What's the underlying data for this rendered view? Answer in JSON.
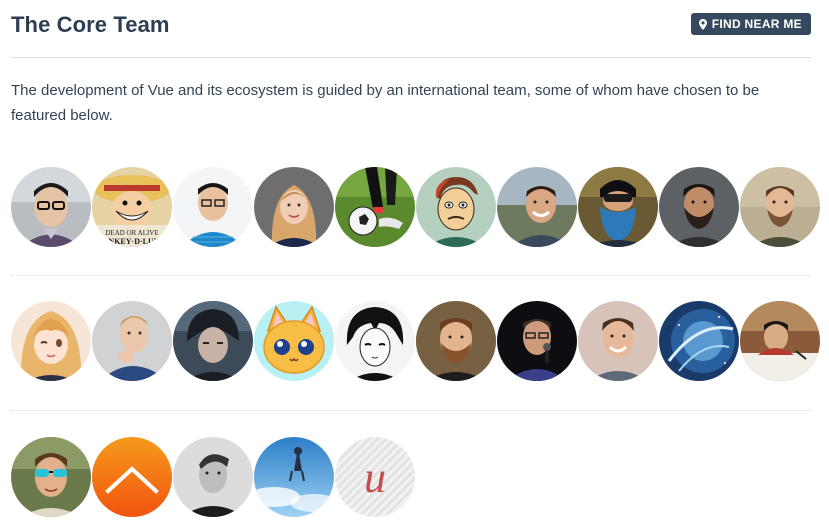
{
  "header": {
    "title": "The Core Team",
    "find_button_label": "FIND NEAR ME"
  },
  "description": "The development of Vue and its ecosystem is guided by an international team, some of whom have chosen to be featured below.",
  "avatars": {
    "row1": [
      {
        "name": "avatar-man-glasses-1"
      },
      {
        "name": "avatar-anime-straw-hat"
      },
      {
        "name": "avatar-man-glasses-blue-shirt"
      },
      {
        "name": "avatar-woman-blonde"
      },
      {
        "name": "avatar-soccer-ball"
      },
      {
        "name": "avatar-cartoon-man"
      },
      {
        "name": "avatar-man-smiling-field"
      },
      {
        "name": "avatar-man-blue-beard"
      },
      {
        "name": "avatar-man-beard-dark"
      },
      {
        "name": "avatar-man-beard-light"
      }
    ],
    "row2": [
      {
        "name": "avatar-anime-girl-wink"
      },
      {
        "name": "avatar-man-thinking"
      },
      {
        "name": "avatar-anime-boy-dark"
      },
      {
        "name": "avatar-cartoon-cat"
      },
      {
        "name": "avatar-manga-boy"
      },
      {
        "name": "avatar-man-beard-red"
      },
      {
        "name": "avatar-man-speaking-mic"
      },
      {
        "name": "avatar-man-smiling-wall"
      },
      {
        "name": "avatar-space-blue"
      },
      {
        "name": "avatar-boy-writing"
      }
    ],
    "row3": [
      {
        "name": "avatar-man-sunglasses"
      },
      {
        "name": "avatar-orange-logo"
      },
      {
        "name": "avatar-man-bw"
      },
      {
        "name": "avatar-anime-sky"
      },
      {
        "name": "avatar-letter-u-logo"
      }
    ]
  }
}
